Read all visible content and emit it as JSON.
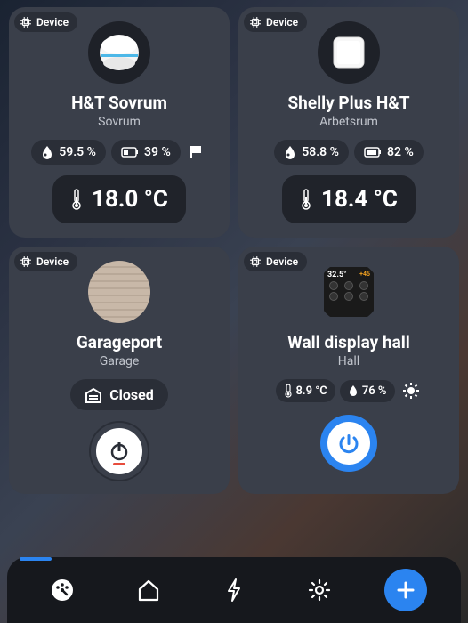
{
  "tag_label": "Device",
  "cards": [
    {
      "name": "H&T Sovrum",
      "room": "Sovrum",
      "humidity": "59.5 %",
      "battery": "39 %",
      "temperature": "18.0 °C"
    },
    {
      "name": "Shelly Plus H&T",
      "room": "Arbetsrum",
      "humidity": "58.8 %",
      "battery": "82 %",
      "temperature": "18.4 °C"
    },
    {
      "name": "Garageport",
      "room": "Garage",
      "status": "Closed"
    },
    {
      "name": "Wall display hall",
      "room": "Hall",
      "temp_small": "8.9 °C",
      "humidity": "76 %",
      "wd_temp": "32.5°",
      "wd_watts": "+45"
    }
  ]
}
